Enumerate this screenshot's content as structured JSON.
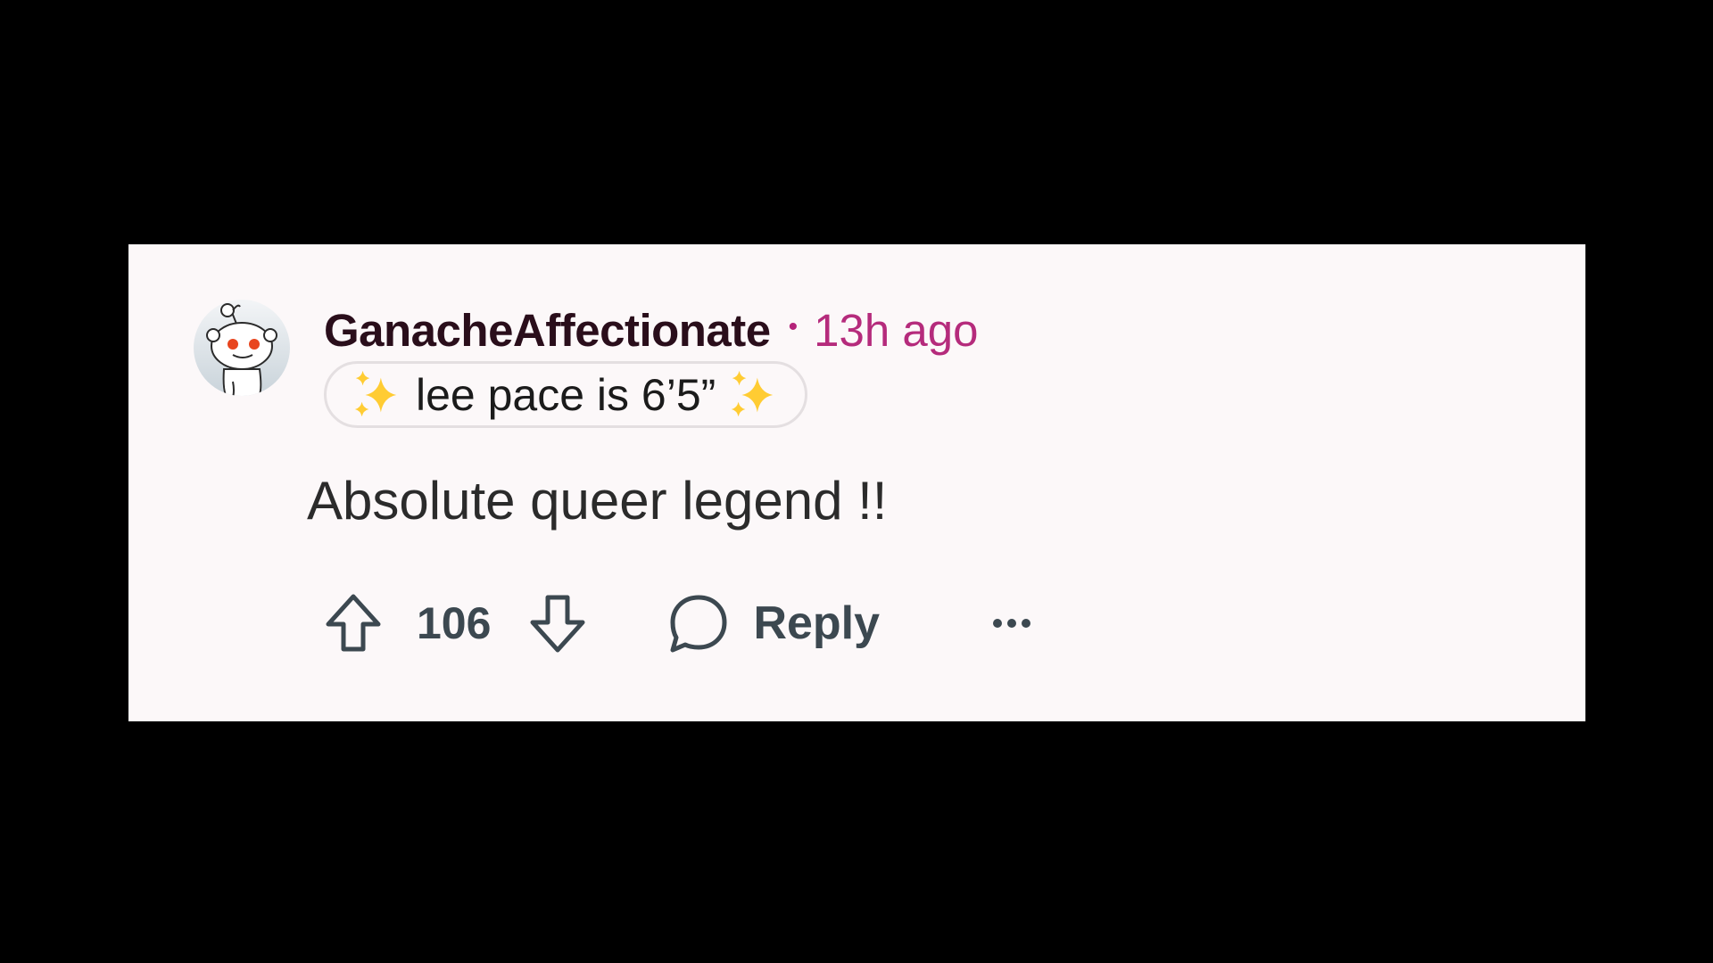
{
  "comment": {
    "username": "GanacheAffectionate",
    "separator": "•",
    "timestamp": "13h ago",
    "flair_text": "lee pace is 6’5”",
    "body": "Absolute queer legend !!",
    "vote_count": "106",
    "reply_label": "Reply"
  },
  "icons": {
    "avatar": "reddit-snoo-avatar",
    "sparkle": "sparkles-emoji",
    "upvote": "upvote-arrow-icon",
    "downvote": "downvote-arrow-icon",
    "reply": "speech-bubble-icon",
    "more": "ellipsis-icon"
  },
  "colors": {
    "background": "#000000",
    "card": "#fcf8f9",
    "username": "#2a0e1b",
    "timestamp": "#b52b7c",
    "action_gray": "#3c4850"
  }
}
